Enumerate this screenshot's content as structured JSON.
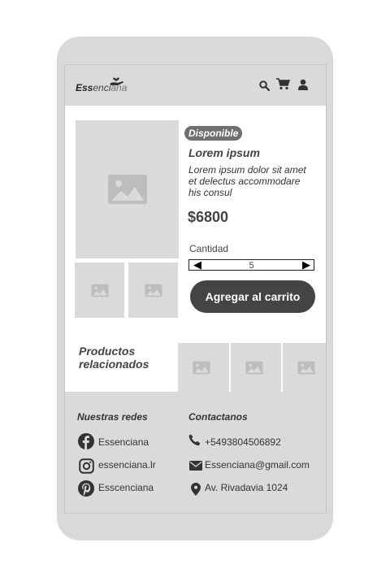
{
  "header": {
    "logo": {
      "part1": "Ess",
      "part2": "enci",
      "part3": "ana"
    },
    "icons": [
      "search-icon",
      "cart-icon",
      "user-icon"
    ]
  },
  "product": {
    "badge": "Disponible",
    "title": "Lorem ipsum",
    "description": "Lorem ipsum dolor sit amet et delectus accommodare his consul",
    "price": "$6800",
    "quantity_label": "Cantidad",
    "quantity_value": "5",
    "add_to_cart": "Agregar al carrito"
  },
  "related": {
    "label": "Productos relacionados"
  },
  "footer": {
    "social_title": "Nuestras redes",
    "contact_title": "Contactanos",
    "social": [
      {
        "icon": "facebook-icon",
        "text": "Essenciana"
      },
      {
        "icon": "instagram-icon",
        "text": "essenciana.lr"
      },
      {
        "icon": "pinterest-icon",
        "text": "Esscenciana"
      }
    ],
    "contact": [
      {
        "icon": "phone-icon",
        "text": "+5493804506892"
      },
      {
        "icon": "mail-icon",
        "text": "Essenciana@gmail.com"
      },
      {
        "icon": "location-icon",
        "text": "Av. Rivadavia 1024"
      }
    ]
  },
  "colors": {
    "frame": "#d9d9d9",
    "panel": "#dadada",
    "button": "#444444",
    "badge": "#6f6f6f"
  }
}
